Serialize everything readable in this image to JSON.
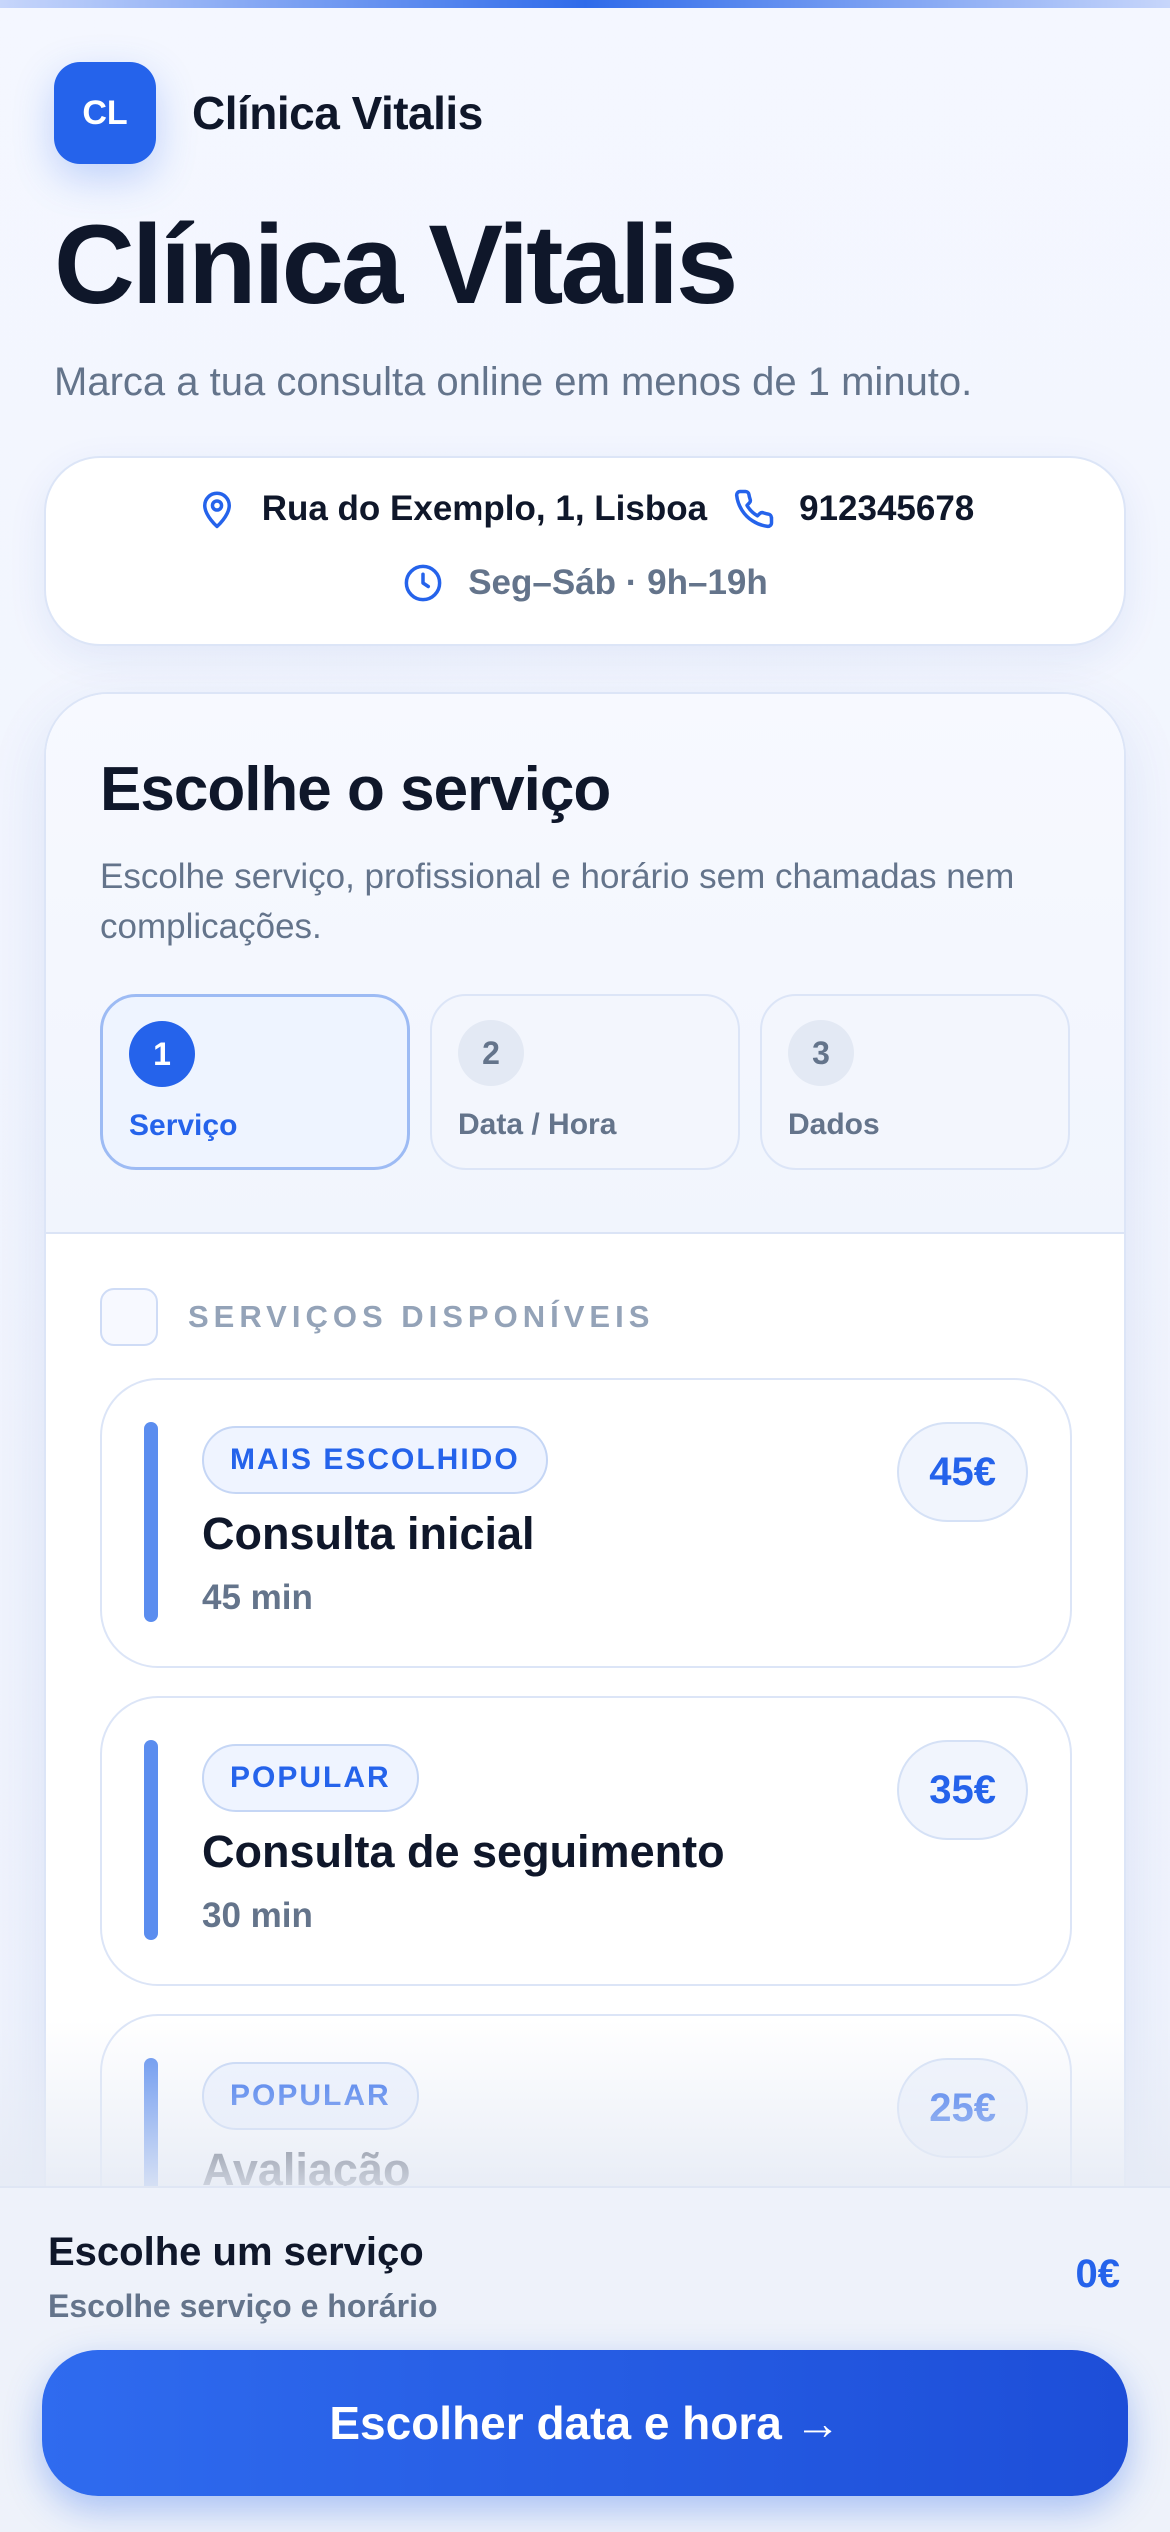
{
  "brand": {
    "logo_initials": "CL",
    "name": "Clínica Vitalis"
  },
  "hero": {
    "title": "Clínica Vitalis",
    "subtitle": "Marca a tua consulta online em menos de 1 minuto."
  },
  "contact": {
    "address": "Rua do Exemplo, 1, Lisboa",
    "phone": "912345678",
    "hours": "Seg–Sáb · 9h–19h",
    "icons": [
      "location-pin-icon",
      "phone-icon",
      "clock-icon"
    ]
  },
  "booking": {
    "title": "Escolhe o serviço",
    "description": "Escolhe serviço, profissional e horário sem chamadas nem complicações.",
    "steps": [
      {
        "number": "1",
        "label": "Serviço",
        "active": true
      },
      {
        "number": "2",
        "label": "Data / Hora",
        "active": false
      },
      {
        "number": "3",
        "label": "Dados",
        "active": false
      }
    ],
    "section_label": "SERVIÇOS DISPONÍVEIS",
    "services": [
      {
        "badge": "MAIS ESCOLHIDO",
        "name": "Consulta inicial",
        "duration": "45 min",
        "price": "45€"
      },
      {
        "badge": "POPULAR",
        "name": "Consulta de seguimento",
        "duration": "30 min",
        "price": "35€"
      },
      {
        "badge": "POPULAR",
        "name": "Avaliação",
        "duration": "",
        "price": "25€"
      }
    ]
  },
  "summary": {
    "title": "Escolhe um serviço",
    "subtitle": "Escolhe serviço e horário",
    "total": "0€",
    "cta_label": "Escolher data e hora →"
  },
  "colors": {
    "accent": "#2563eb",
    "text": "#0f172a",
    "muted": "#64748b"
  }
}
